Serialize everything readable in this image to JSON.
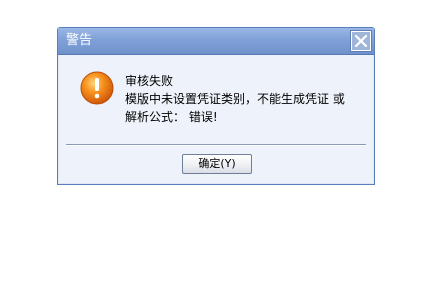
{
  "dialog": {
    "title": "警告",
    "close_icon": "close-icon",
    "icon": "warning-icon",
    "message_lines": [
      "审核失败",
      "模版中未设置凭证类别，不能生成凭证 或",
      "解析公式： 错误!"
    ],
    "ok_label": "确定(Y)"
  }
}
